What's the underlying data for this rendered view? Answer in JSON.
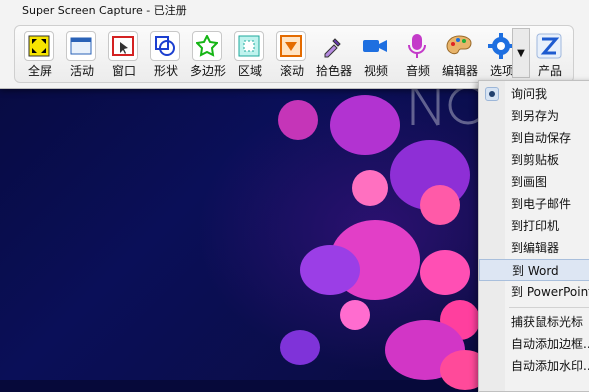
{
  "window": {
    "title": "Super Screen Capture - 已注册"
  },
  "toolbar": {
    "tools": [
      {
        "label": "全屏",
        "icon": "fullscreen-icon"
      },
      {
        "label": "活动",
        "icon": "active-window-icon"
      },
      {
        "label": "窗口",
        "icon": "window-icon"
      },
      {
        "label": "形状",
        "icon": "shape-icon"
      },
      {
        "label": "多边形",
        "icon": "polygon-icon"
      },
      {
        "label": "区域",
        "icon": "region-icon"
      },
      {
        "label": "滚动",
        "icon": "scroll-icon"
      },
      {
        "label": "拾色器",
        "icon": "eyedropper-icon"
      },
      {
        "label": "视频",
        "icon": "video-camera-icon"
      },
      {
        "label": "音频",
        "icon": "microphone-icon"
      },
      {
        "label": "编辑器",
        "icon": "palette-icon"
      },
      {
        "label": "选项",
        "icon": "gear-icon"
      },
      {
        "label": "产品",
        "icon": "product-z-icon"
      }
    ],
    "dropdown_glyph": "▼"
  },
  "menu": {
    "items": [
      {
        "label": "询问我",
        "checked": true
      },
      {
        "label": "到另存为"
      },
      {
        "label": "到自动保存"
      },
      {
        "label": "到剪贴板"
      },
      {
        "label": "到画图"
      },
      {
        "label": "到电子邮件"
      },
      {
        "label": "到打印机"
      },
      {
        "label": "到编辑器"
      },
      {
        "label": "到 Word",
        "highlighted": true
      },
      {
        "label": "到 PowerPoint"
      },
      {
        "label": "捕获鼠标光标"
      },
      {
        "label": "自动添加边框..."
      },
      {
        "label": "自动添加水印..."
      }
    ]
  },
  "colors": {
    "accent_highlight": "#dde6f3",
    "wallpaper_dark": "#0a0f58",
    "bubble_pink": "#ff4fb4",
    "bubble_purple": "#a23be0"
  }
}
